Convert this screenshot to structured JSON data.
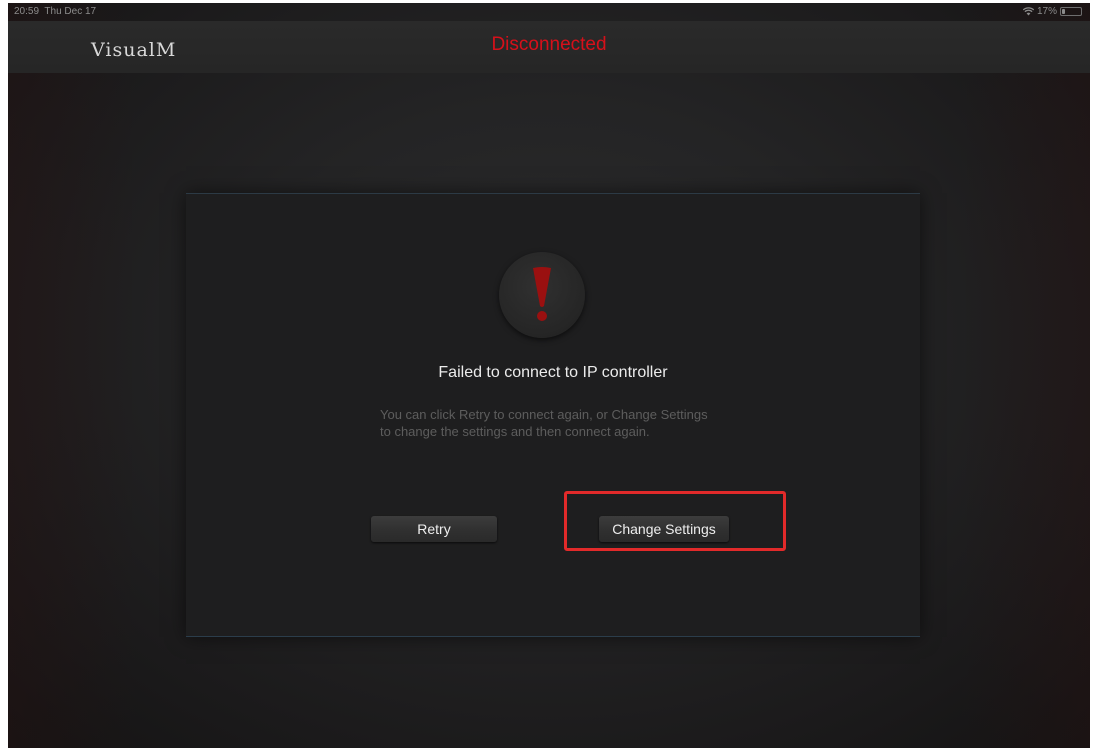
{
  "status_bar": {
    "time": "20:59",
    "date": "Thu Dec 17",
    "battery": "17%",
    "battery_level": 0.17,
    "wifi_icon": "wifi-icon",
    "battery_icon": "battery-icon"
  },
  "nav": {
    "app_title": "VisualM",
    "connection_status": "Disconnected",
    "status_color": "#d6101a"
  },
  "dialog": {
    "icon": "exclamation-icon",
    "icon_color": "#9a1010",
    "title": "Failed to connect to IP controller",
    "message": "You can click Retry to connect again, or Change Settings to change the settings and then connect again.",
    "retry_label": "Retry",
    "change_settings_label": "Change Settings"
  },
  "annotation": {
    "highlight_color": "#e22a2a"
  }
}
